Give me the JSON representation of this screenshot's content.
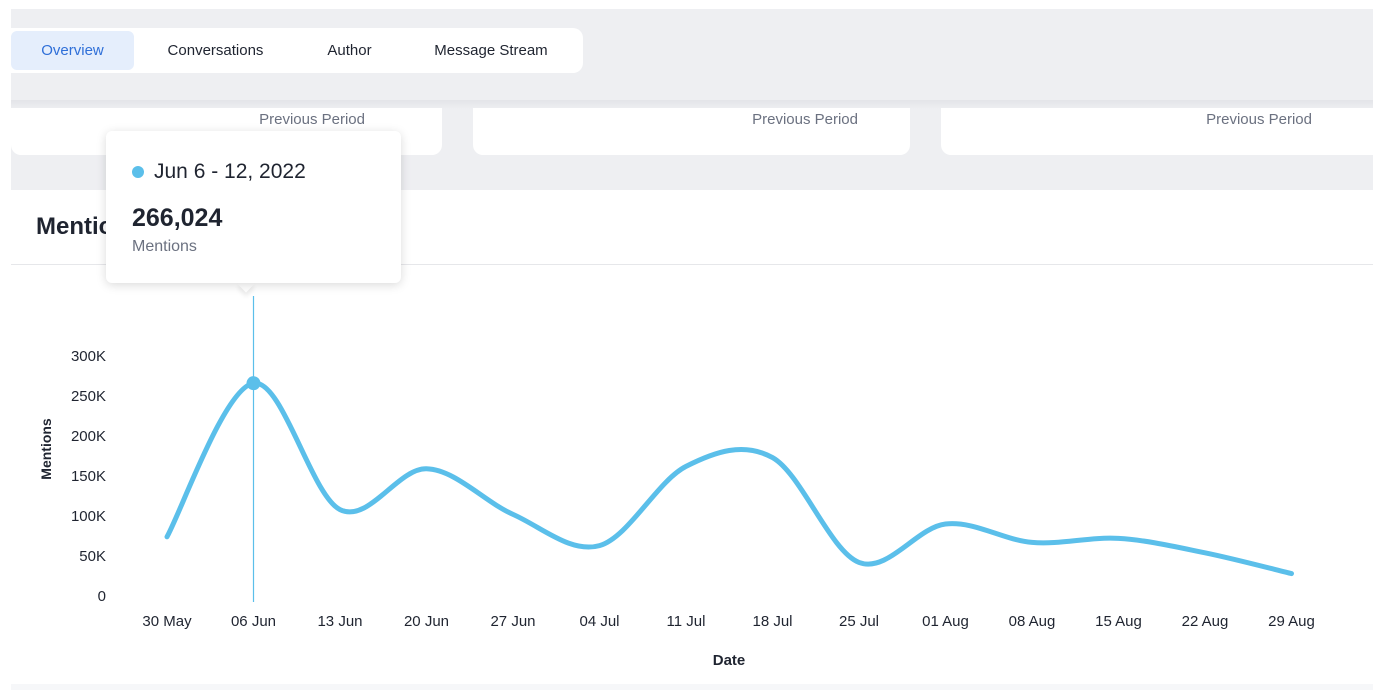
{
  "tabs": [
    {
      "label": "Overview",
      "active": true
    },
    {
      "label": "Conversations",
      "active": false
    },
    {
      "label": "Author",
      "active": false
    },
    {
      "label": "Message Stream",
      "active": false
    }
  ],
  "cards": [
    {
      "label": "Previous Period"
    },
    {
      "label": "Previous Period"
    },
    {
      "label": "Previous Period"
    }
  ],
  "section": {
    "title": "Mentions"
  },
  "tooltip": {
    "date_range": "Jun 6 - 12, 2022",
    "value": "266,024",
    "metric": "Mentions"
  },
  "colors": {
    "series": "#5bbfea",
    "accent": "#2f6fd8"
  },
  "chart_data": {
    "type": "line",
    "xlabel": "Date",
    "ylabel": "Mentions",
    "ylim": [
      0,
      300000
    ],
    "yticks": [
      {
        "value": 0,
        "label": "0"
      },
      {
        "value": 50000,
        "label": "50K"
      },
      {
        "value": 100000,
        "label": "100K"
      },
      {
        "value": 150000,
        "label": "150K"
      },
      {
        "value": 200000,
        "label": "200K"
      },
      {
        "value": 250000,
        "label": "250K"
      },
      {
        "value": 300000,
        "label": "300K"
      }
    ],
    "categories": [
      "30 May",
      "06 Jun",
      "13 Jun",
      "20 Jun",
      "27 Jun",
      "04 Jul",
      "11 Jul",
      "18 Jul",
      "25 Jul",
      "01 Aug",
      "08 Aug",
      "15 Aug",
      "22 Aug",
      "29 Aug"
    ],
    "series": [
      {
        "values": [
          74000,
          266024,
          108000,
          159000,
          102000,
          63000,
          162000,
          173000,
          42000,
          90000,
          67000,
          72000,
          54000,
          28000
        ]
      }
    ],
    "highlight_index": 1,
    "grid": false,
    "legend": "none"
  }
}
